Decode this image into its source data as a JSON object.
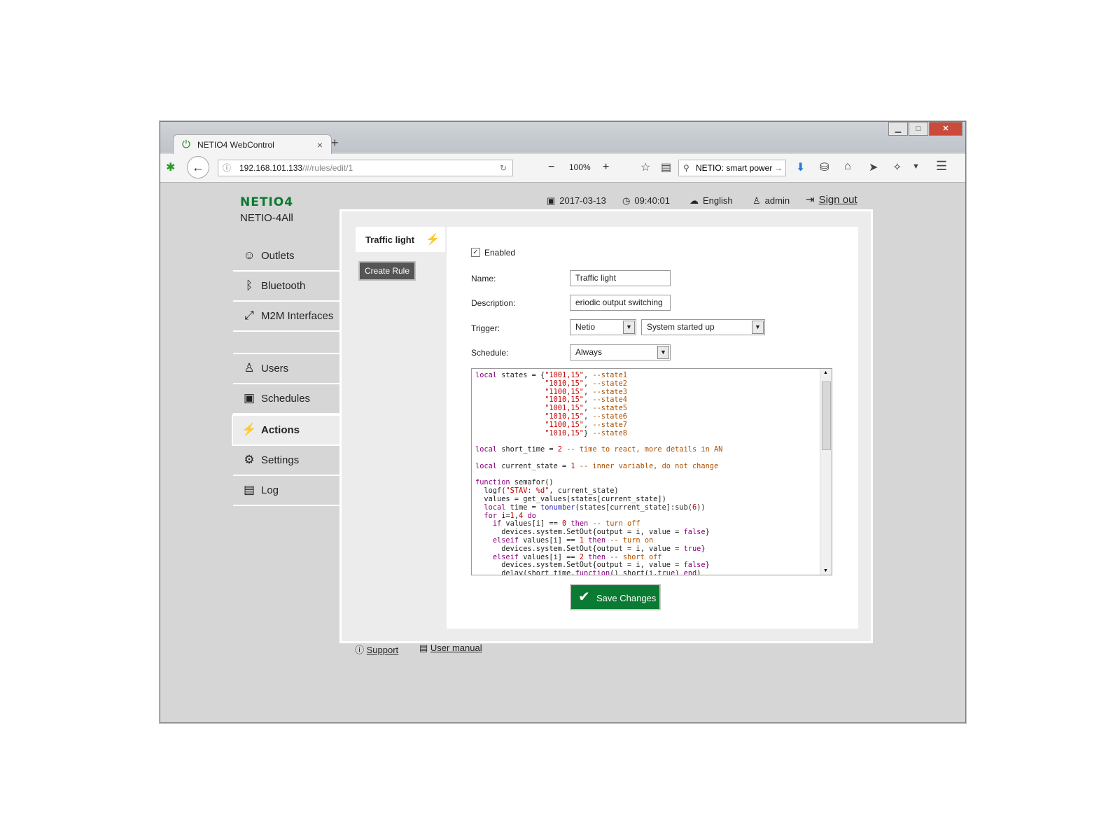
{
  "browser": {
    "tab_title": "NETIO4 WebControl",
    "new_tab": "+",
    "close_tab": "×",
    "url_host": "192.168.101.133",
    "url_path": "/#/rules/edit/1",
    "zoom_minus": "−",
    "zoom_level": "100%",
    "zoom_plus": "+",
    "search_text": "NETIO: smart power",
    "win_min": "▁",
    "win_max": "□",
    "win_close": "✕"
  },
  "header": {
    "logo": "NETIO4",
    "device_name": "NETIO-4All",
    "date": "2017-03-13",
    "time": "09:40:01",
    "language": "English",
    "user": "admin",
    "signout": "Sign out"
  },
  "menu": {
    "outlets": "Outlets",
    "bluetooth": "Bluetooth",
    "m2m": "M2M Interfaces",
    "users": "Users",
    "schedules": "Schedules",
    "actions": "Actions",
    "settings": "Settings",
    "log": "Log"
  },
  "rules": {
    "tab_label": "Traffic light",
    "create_rule": "Create Rule"
  },
  "form": {
    "enabled_label": "Enabled",
    "name_label": "Name:",
    "name_value": "Traffic light",
    "description_label": "Description:",
    "description_value": "eriodic output switching",
    "trigger_label": "Trigger:",
    "trigger_source": "Netio",
    "trigger_event": "System started up",
    "schedule_label": "Schedule:",
    "schedule_value": "Always",
    "save_label": "Save Changes"
  },
  "footer": {
    "support": "Support",
    "manual": "User manual"
  },
  "icons": {
    "power": "power-icon",
    "outlets": "outlet-icon",
    "bluetooth": "bluetooth-icon",
    "m2m": "m2m-icon",
    "users": "user-icon",
    "schedules": "calendar-icon",
    "actions": "wand-icon",
    "settings": "gear-icon",
    "log": "document-icon"
  },
  "colors": {
    "brand_green": "#0b7a32",
    "keyword": "#8b0080",
    "string": "#c00000",
    "comment": "#b05000"
  }
}
